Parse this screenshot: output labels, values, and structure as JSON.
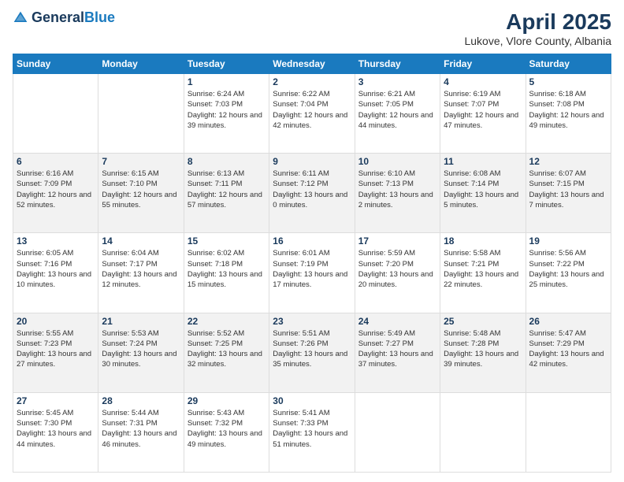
{
  "logo": {
    "general": "General",
    "blue": "Blue"
  },
  "header": {
    "title": "April 2025",
    "subtitle": "Lukove, Vlore County, Albania"
  },
  "days_of_week": [
    "Sunday",
    "Monday",
    "Tuesday",
    "Wednesday",
    "Thursday",
    "Friday",
    "Saturday"
  ],
  "weeks": [
    [
      {
        "day": "",
        "info": ""
      },
      {
        "day": "",
        "info": ""
      },
      {
        "day": "1",
        "info": "Sunrise: 6:24 AM\nSunset: 7:03 PM\nDaylight: 12 hours and 39 minutes."
      },
      {
        "day": "2",
        "info": "Sunrise: 6:22 AM\nSunset: 7:04 PM\nDaylight: 12 hours and 42 minutes."
      },
      {
        "day": "3",
        "info": "Sunrise: 6:21 AM\nSunset: 7:05 PM\nDaylight: 12 hours and 44 minutes."
      },
      {
        "day": "4",
        "info": "Sunrise: 6:19 AM\nSunset: 7:07 PM\nDaylight: 12 hours and 47 minutes."
      },
      {
        "day": "5",
        "info": "Sunrise: 6:18 AM\nSunset: 7:08 PM\nDaylight: 12 hours and 49 minutes."
      }
    ],
    [
      {
        "day": "6",
        "info": "Sunrise: 6:16 AM\nSunset: 7:09 PM\nDaylight: 12 hours and 52 minutes."
      },
      {
        "day": "7",
        "info": "Sunrise: 6:15 AM\nSunset: 7:10 PM\nDaylight: 12 hours and 55 minutes."
      },
      {
        "day": "8",
        "info": "Sunrise: 6:13 AM\nSunset: 7:11 PM\nDaylight: 12 hours and 57 minutes."
      },
      {
        "day": "9",
        "info": "Sunrise: 6:11 AM\nSunset: 7:12 PM\nDaylight: 13 hours and 0 minutes."
      },
      {
        "day": "10",
        "info": "Sunrise: 6:10 AM\nSunset: 7:13 PM\nDaylight: 13 hours and 2 minutes."
      },
      {
        "day": "11",
        "info": "Sunrise: 6:08 AM\nSunset: 7:14 PM\nDaylight: 13 hours and 5 minutes."
      },
      {
        "day": "12",
        "info": "Sunrise: 6:07 AM\nSunset: 7:15 PM\nDaylight: 13 hours and 7 minutes."
      }
    ],
    [
      {
        "day": "13",
        "info": "Sunrise: 6:05 AM\nSunset: 7:16 PM\nDaylight: 13 hours and 10 minutes."
      },
      {
        "day": "14",
        "info": "Sunrise: 6:04 AM\nSunset: 7:17 PM\nDaylight: 13 hours and 12 minutes."
      },
      {
        "day": "15",
        "info": "Sunrise: 6:02 AM\nSunset: 7:18 PM\nDaylight: 13 hours and 15 minutes."
      },
      {
        "day": "16",
        "info": "Sunrise: 6:01 AM\nSunset: 7:19 PM\nDaylight: 13 hours and 17 minutes."
      },
      {
        "day": "17",
        "info": "Sunrise: 5:59 AM\nSunset: 7:20 PM\nDaylight: 13 hours and 20 minutes."
      },
      {
        "day": "18",
        "info": "Sunrise: 5:58 AM\nSunset: 7:21 PM\nDaylight: 13 hours and 22 minutes."
      },
      {
        "day": "19",
        "info": "Sunrise: 5:56 AM\nSunset: 7:22 PM\nDaylight: 13 hours and 25 minutes."
      }
    ],
    [
      {
        "day": "20",
        "info": "Sunrise: 5:55 AM\nSunset: 7:23 PM\nDaylight: 13 hours and 27 minutes."
      },
      {
        "day": "21",
        "info": "Sunrise: 5:53 AM\nSunset: 7:24 PM\nDaylight: 13 hours and 30 minutes."
      },
      {
        "day": "22",
        "info": "Sunrise: 5:52 AM\nSunset: 7:25 PM\nDaylight: 13 hours and 32 minutes."
      },
      {
        "day": "23",
        "info": "Sunrise: 5:51 AM\nSunset: 7:26 PM\nDaylight: 13 hours and 35 minutes."
      },
      {
        "day": "24",
        "info": "Sunrise: 5:49 AM\nSunset: 7:27 PM\nDaylight: 13 hours and 37 minutes."
      },
      {
        "day": "25",
        "info": "Sunrise: 5:48 AM\nSunset: 7:28 PM\nDaylight: 13 hours and 39 minutes."
      },
      {
        "day": "26",
        "info": "Sunrise: 5:47 AM\nSunset: 7:29 PM\nDaylight: 13 hours and 42 minutes."
      }
    ],
    [
      {
        "day": "27",
        "info": "Sunrise: 5:45 AM\nSunset: 7:30 PM\nDaylight: 13 hours and 44 minutes."
      },
      {
        "day": "28",
        "info": "Sunrise: 5:44 AM\nSunset: 7:31 PM\nDaylight: 13 hours and 46 minutes."
      },
      {
        "day": "29",
        "info": "Sunrise: 5:43 AM\nSunset: 7:32 PM\nDaylight: 13 hours and 49 minutes."
      },
      {
        "day": "30",
        "info": "Sunrise: 5:41 AM\nSunset: 7:33 PM\nDaylight: 13 hours and 51 minutes."
      },
      {
        "day": "",
        "info": ""
      },
      {
        "day": "",
        "info": ""
      },
      {
        "day": "",
        "info": ""
      }
    ]
  ]
}
